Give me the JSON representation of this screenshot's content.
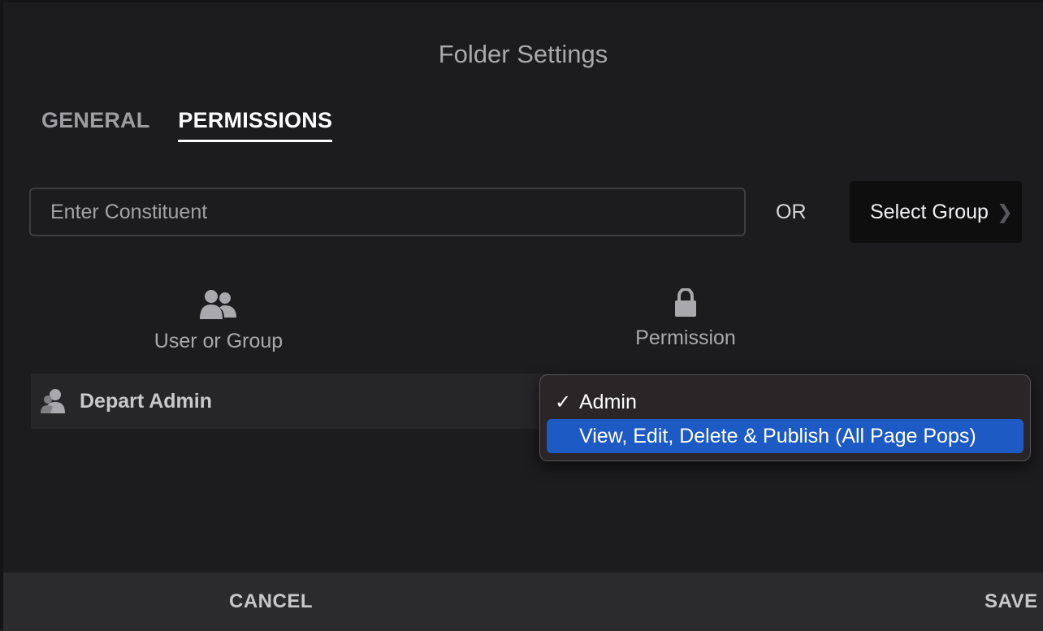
{
  "dialog": {
    "title": "Folder Settings"
  },
  "tabs": [
    {
      "label": "GENERAL",
      "active": false
    },
    {
      "label": "PERMISSIONS",
      "active": true
    }
  ],
  "search": {
    "placeholder": "Enter Constituent",
    "value": ""
  },
  "or_label": "OR",
  "select_group": {
    "label": "Select Group",
    "icon": "chevron-right-icon"
  },
  "columns": {
    "user": {
      "label": "User or Group",
      "icon": "users-icon"
    },
    "permission": {
      "label": "Permission",
      "icon": "lock-icon"
    }
  },
  "rows": [
    {
      "name": "Depart Admin",
      "icon": "user-group-icon"
    }
  ],
  "permission_dropdown": {
    "options": [
      {
        "label": "Admin",
        "checked": true,
        "highlighted": false
      },
      {
        "label": "View, Edit, Delete & Publish (All Page Pops)",
        "checked": false,
        "highlighted": true
      }
    ],
    "highlight_color": "#1d5ac4"
  },
  "footer": {
    "cancel_label": "CANCEL",
    "save_label": "SAVE"
  },
  "colors": {
    "background": "#1c1c1e",
    "footer": "#2b2b2e",
    "row": "#262628"
  }
}
